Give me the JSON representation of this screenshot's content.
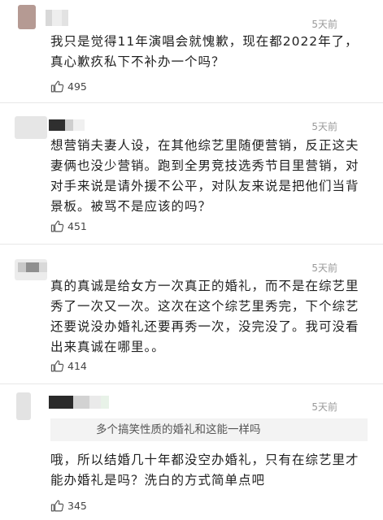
{
  "comments": [
    {
      "time": "5天前",
      "lines": [
        "我只是觉得11年演唱会就愧歉，现在都2022年了，",
        "真心歉疚私下不补办一个吗？"
      ],
      "likes": "495"
    },
    {
      "time": "5天前",
      "lines": [
        "想营销夫妻人设，在其他综艺里随便营销，反正这夫",
        "妻俩也没少营销。跑到全男竞技选秀节目里营销，对",
        "对手来说是请外援不公平，对队友来说是把他们当背",
        "景板。被骂不是应该的吗？"
      ],
      "likes": "451"
    },
    {
      "time": "5天前",
      "lines": [
        "真的真诚是给女方一次真正的婚礼，而不是在综艺里",
        "秀了一次又一次。这次在这个综艺里秀完，下个综艺",
        "还要说没办婚礼还要再秀一次，没完没了。我可没看",
        "出来真诚在哪里。。"
      ],
      "likes": "414"
    },
    {
      "time": "5天前",
      "quote": "多个搞笑性质的婚礼和这能一样吗",
      "lines": [
        "哦，所以结婚几十年都没空办婚礼，只有在综艺里才",
        "能办婚礼是吗？洗白的方式简单点吧"
      ],
      "likes": "345"
    }
  ],
  "icons": {
    "like": "thumbs-up-icon"
  }
}
